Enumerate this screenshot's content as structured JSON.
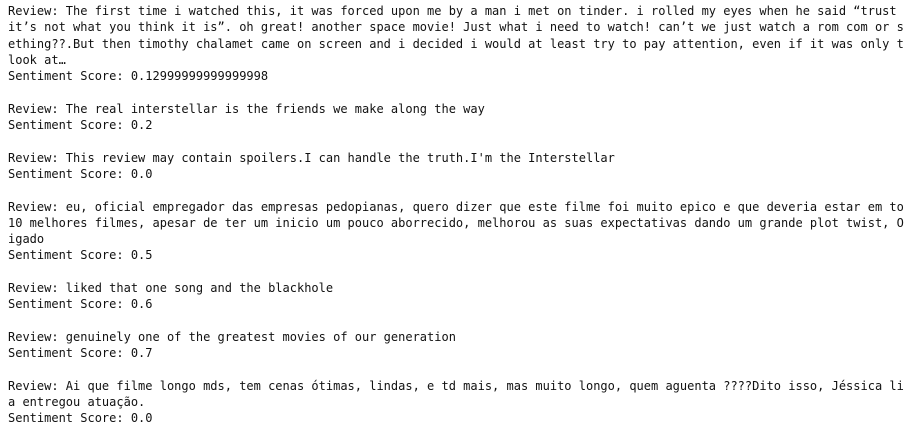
{
  "output": {
    "entries": [
      {
        "review_lines": [
          "Review: The first time i watched this, it was forced upon me by a man i met on tinder. i rolled my eyes when he said “trust me",
          "it’s not what you think it is”. oh great! another space movie! Just what i need to watch! can’t we just watch a rom com or som",
          "ething??.But then timothy chalamet came on screen and i decided i would at least try to pay attention, even if it was only to",
          "look at…"
        ],
        "score_line": "Sentiment Score: 0.12999999999999998"
      },
      {
        "review_lines": [
          "Review: The real interstellar is the friends we make along the way"
        ],
        "score_line": "Sentiment Score: 0.2"
      },
      {
        "review_lines": [
          "Review: This review may contain spoilers.I can handle the truth.I'm the Interstellar"
        ],
        "score_line": "Sentiment Score: 0.0"
      },
      {
        "review_lines": [
          "Review: eu, oficial empregador das empresas pedopianas, quero dizer que este filme foi muito epico e que deveria estar em top",
          "10 melhores filmes, apesar de ter um inicio um pouco aborrecido, melhorou as suas expectativas dando um grande plot twist, Obr",
          "igado"
        ],
        "score_line": "Sentiment Score: 0.5"
      },
      {
        "review_lines": [
          "Review: liked that one song and the blackhole"
        ],
        "score_line": "Sentiment Score: 0.6"
      },
      {
        "review_lines": [
          "Review: genuinely one of the greatest movies of our generation"
        ],
        "score_line": "Sentiment Score: 0.7"
      },
      {
        "review_lines": [
          "Review: Ai que filme longo mds, tem cenas ótimas, lindas, e td mais, mas muito longo, quem aguenta ????Dito isso, Jéssica lind",
          "a entregou atuação."
        ],
        "score_line": "Sentiment Score: 0.0"
      }
    ]
  }
}
